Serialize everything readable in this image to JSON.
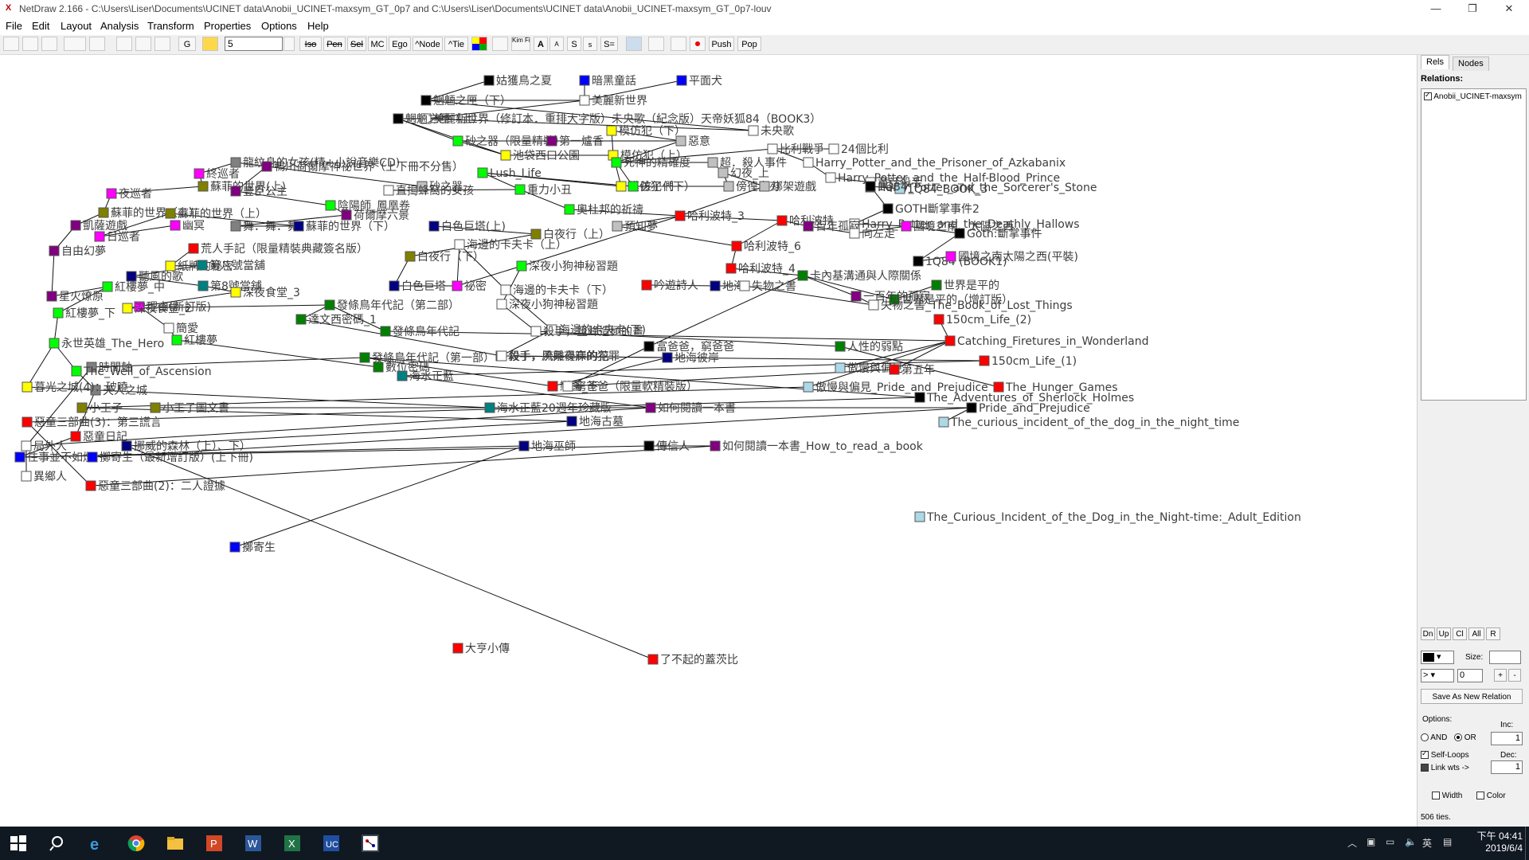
{
  "window": {
    "title": "NetDraw 2.166 - C:\\Users\\Liser\\Documents\\UCINET data\\Anobii_UCINET-maxsym_GT_0p7 and C:\\Users\\Liser\\Documents\\UCINET data\\Anobii_UCINET-maxsym_GT_0p7-louv",
    "app_icon": "netdraw-icon",
    "controls": [
      "—",
      "❐",
      "✕"
    ]
  },
  "menu": [
    "File",
    "Edit",
    "Layout",
    "Analysis",
    "Transform",
    "Properties",
    "Options",
    "Help"
  ],
  "toolbar": {
    "text_buttons": [
      "G",
      "Iso",
      "Pen",
      "Sel",
      "MC",
      "Ego",
      "^Node",
      "^Tie",
      "Kim Fill",
      "A",
      "A",
      "S",
      "s",
      "S=",
      "Push",
      "Pop"
    ],
    "input_value": "5"
  },
  "right_panel": {
    "tabs": [
      "Rels",
      "Nodes"
    ],
    "relations_label": "Relations:",
    "relation_item": "Anobii_UCINET-maxsym",
    "nav_buttons": [
      "Dn",
      "Up",
      "Cl",
      "All",
      "R"
    ],
    "size_label": "Size:",
    "value_field": "0",
    "save_button": "Save As New Relation",
    "options_label": "Options:",
    "and_label": "AND",
    "or_label": "OR",
    "inc_label": "Inc:",
    "inc_value": "1",
    "self_loops_label": "Self-Loops",
    "link_wts_label": "Link wts ->",
    "dec_label": "Dec:",
    "dec_value": "1",
    "width_label": "Width",
    "color_label": "Color",
    "status": "506 ties."
  },
  "taskbar": {
    "time": "下午 04:41",
    "date": "2019/6/4",
    "ime": "英"
  },
  "graph": {
    "nodes": [
      {
        "label": "姑獲鳥之夏",
        "color": "#000000"
      },
      {
        "label": "暗黑童話",
        "color": "#0000ff"
      },
      {
        "label": "平面犬",
        "color": "#0000ff"
      },
      {
        "label": "魍魎之匣（下）",
        "color": "#000000"
      },
      {
        "label": "美麗新世界",
        "color": "#ffffff"
      },
      {
        "label": "美麗新世界（修訂本．重排大字版）未央歌（紀念版）天帝妖狐84（BOOK3）",
        "color": "#ffffff"
      },
      {
        "label": "魍魎之匣（上）",
        "color": "#000000"
      },
      {
        "label": "模仿犯（下）",
        "color": "#ffff00"
      },
      {
        "label": "未央歌",
        "color": "#ffffff"
      },
      {
        "label": "砂之器（限量精裝）",
        "color": "#00ff00"
      },
      {
        "label": "第一爐香",
        "color": "#800080"
      },
      {
        "label": "惡意",
        "color": "#c0c0c0"
      },
      {
        "label": "比利戰爭",
        "color": "#ffffff"
      },
      {
        "label": "24個比利",
        "color": "#ffffff"
      },
      {
        "label": "池袋西口公園",
        "color": "#ffff00"
      },
      {
        "label": "模仿犯（上）",
        "color": "#ffff00"
      },
      {
        "label": "龍紋身的女孩(精+小說音樂CD)",
        "color": "#808080"
      },
      {
        "label": "死神的精確度",
        "color": "#00ff00"
      },
      {
        "label": "超．殺人事件",
        "color": "#c0c0c0"
      },
      {
        "label": "Harry_Potter_and_the_Prisoner_of_Azkabanix",
        "color": "#ffffff"
      },
      {
        "label": "幻夜_上",
        "color": "#c0c0c0"
      },
      {
        "label": "Harry_Potter_and_the_Half-Blood_Prince",
        "color": "#ffffff"
      },
      {
        "label": "鴨川荷爾摩神祕世界（上下冊不分售）",
        "color": "#800080"
      },
      {
        "label": "砂之器",
        "color": "#c0c0c0"
      },
      {
        "label": "模仿犯（下）",
        "color": "#ffff00"
      },
      {
        "label": "孩子們",
        "color": "#00ff00"
      },
      {
        "label": "傍徨之刃",
        "color": "#c0c0c0"
      },
      {
        "label": "童話殺手",
        "color": "#ffffff"
      },
      {
        "label": "Harry_Potter_and_the_Sorcerer's_Stone",
        "color": "#ffffff"
      },
      {
        "label": "終巡者",
        "color": "#ff00ff"
      },
      {
        "label": "蘇菲的世界(上)",
        "color": "#808000"
      },
      {
        "label": "Lush_Life",
        "color": "#00ff00"
      },
      {
        "label": "1Q84_BOOK_3",
        "color": "#add8e6"
      },
      {
        "label": "1Q84",
        "color": "#000000"
      },
      {
        "label": "夜巡者",
        "color": "#ff00ff"
      },
      {
        "label": "蘇菲的世界（上）",
        "color": "#808000"
      },
      {
        "label": "豐臣公主",
        "color": "#800080"
      },
      {
        "label": "直搗蜂窩的女孩",
        "color": "#ffffff"
      },
      {
        "label": "重力小丑",
        "color": "#00ff00"
      },
      {
        "label": "綁架遊戲",
        "color": "#c0c0c0"
      },
      {
        "label": "陰陽師_鳳凰卷",
        "color": "#00ff00"
      },
      {
        "label": "GOTH斷掌事件2",
        "color": "#000000"
      },
      {
        "label": "奧杜邦的祈禱",
        "color": "#00ff00"
      },
      {
        "label": "哈利波特_3",
        "color": "#ff0000"
      },
      {
        "label": "哈利波特",
        "color": "#ff0000"
      },
      {
        "label": "荷爾摩六景",
        "color": "#800080"
      },
      {
        "label": "Harry_Potter_and_the_Deathly_Hallows",
        "color": "#ffffff"
      },
      {
        "label": "國境之南、太陽之西",
        "color": "#ff00ff"
      },
      {
        "label": "蘇菲的世界（上）",
        "color": "#808000"
      },
      {
        "label": "凱薩遊戲",
        "color": "#800080"
      },
      {
        "label": "幽冥",
        "color": "#ff00ff"
      },
      {
        "label": "舞．舞．舞",
        "color": "#808080"
      },
      {
        "label": "蘇菲的世界（下）",
        "color": "#000080"
      },
      {
        "label": "白色巨塔(上)",
        "color": "#000080"
      },
      {
        "label": "百年孤寂",
        "color": "#800080"
      },
      {
        "label": "向左走",
        "color": "#ffffff"
      },
      {
        "label": "Goth:斷掌事件",
        "color": "#000000"
      },
      {
        "label": "日巡者",
        "color": "#ff00ff"
      },
      {
        "label": "預知夢",
        "color": "#c0c0c0"
      },
      {
        "label": "白夜行（上）",
        "color": "#808000"
      },
      {
        "label": "哈利波特_6",
        "color": "#ff0000"
      },
      {
        "label": "自由幻夢",
        "color": "#800080"
      },
      {
        "label": "荒人手記（限量精裝典藏簽名版）",
        "color": "#ff0000"
      },
      {
        "label": "海邊的卡夫卡（上）",
        "color": "#ffffff"
      },
      {
        "label": "1Q84 (BOOK1)",
        "color": "#000000"
      },
      {
        "label": "國境之南太陽之西(平裝)",
        "color": "#ff00ff"
      },
      {
        "label": "白夜行（下）",
        "color": "#808000"
      },
      {
        "label": "世界是平的",
        "color": "#008000"
      },
      {
        "label": "紙牌的秘密",
        "color": "#ffff00"
      },
      {
        "label": "第八號當舖",
        "color": "#008080"
      },
      {
        "label": "深夜小狗神秘習題",
        "color": "#00ff00"
      },
      {
        "label": "哈利波特_4",
        "color": "#ff0000"
      },
      {
        "label": "卡內基溝通與人際關係",
        "color": "#008000"
      },
      {
        "label": "聽風的歌",
        "color": "#000080"
      },
      {
        "label": "白色巨塔",
        "color": "#000080"
      },
      {
        "label": "祕密",
        "color": "#ff00ff"
      },
      {
        "label": "吟遊詩人",
        "color": "#ff0000"
      },
      {
        "label": "地海",
        "color": "#000080"
      },
      {
        "label": "失物之書",
        "color": "#ffffff"
      },
      {
        "label": "世界是平的（增訂版）",
        "color": "#008000"
      },
      {
        "label": "紅樓夢_中",
        "color": "#00ff00"
      },
      {
        "label": "第8號當舖",
        "color": "#008080"
      },
      {
        "label": "深夜食堂_3",
        "color": "#ffff00"
      },
      {
        "label": "星火燎原",
        "color": "#800080"
      },
      {
        "label": "海邊的卡夫卡（下）",
        "color": "#ffffff"
      },
      {
        "label": "一百年的孤寂",
        "color": "#800080"
      },
      {
        "label": "失物之書_The_Book_of_Lost_Things",
        "color": "#ffffff"
      },
      {
        "label": "理由(新訂版)",
        "color": "#ff00ff"
      },
      {
        "label": "深夜食堂_2",
        "color": "#ffff00"
      },
      {
        "label": "發條鳥年代記（第二部）",
        "color": "#008000"
      },
      {
        "label": "深夜小狗神秘習題",
        "color": "#ffffff"
      },
      {
        "label": "紅樓夢_下",
        "color": "#00ff00"
      },
      {
        "label": "達文西密碼_1",
        "color": "#008000"
      },
      {
        "label": "150cm_Life_(2)",
        "color": "#ff0000"
      },
      {
        "label": "簡愛",
        "color": "#ffffff"
      },
      {
        "label": "發條鳥年代記",
        "color": "#008000"
      },
      {
        "label": "海邊的卡夫卡(下)",
        "color": "#ffffff"
      },
      {
        "label": "殺手，登峰造極的畫",
        "color": "#ffffff"
      },
      {
        "label": "紅樓夢",
        "color": "#00ff00"
      },
      {
        "label": "Catching_Firetures_in_Wonderland",
        "color": "#ff0000"
      },
      {
        "label": "永世英雄_The_Hero",
        "color": "#00ff00"
      },
      {
        "label": "殺手，夙興夜寐的犯罪",
        "color": "#ffffff"
      },
      {
        "label": "人性的弱點",
        "color": "#008000"
      },
      {
        "label": "富爸爸，窮爸爸",
        "color": "#000000"
      },
      {
        "label": "發條鳥年代記（第一部）",
        "color": "#008000"
      },
      {
        "label": "殺手，流離尋岸的花",
        "color": "#ffffff"
      },
      {
        "label": "地海彼岸",
        "color": "#000080"
      },
      {
        "label": "時間軸",
        "color": "#808080"
      },
      {
        "label": "數位密碼",
        "color": "#008000"
      },
      {
        "label": "150cm_Life_(1)",
        "color": "#ff0000"
      },
      {
        "label": "The_Well_of_Ascension",
        "color": "#00ff00"
      },
      {
        "label": "傲慢與偏見",
        "color": "#add8e6"
      },
      {
        "label": "海水正藍",
        "color": "#008080"
      },
      {
        "label": "第五年",
        "color": "#ff0000"
      },
      {
        "label": "天人之城",
        "color": "#808080"
      },
      {
        "label": "暮光之城(4)：破曉",
        "color": "#ffff00"
      },
      {
        "label": "戀園_下",
        "color": "#ff0000"
      },
      {
        "label": "The_Hunger_Games",
        "color": "#ff0000"
      },
      {
        "label": "傲慢與偏見_Pride_and_Prejudice",
        "color": "#add8e6"
      },
      {
        "label": "窮爸爸（限量軟精裝版）",
        "color": "#ffffff"
      },
      {
        "label": "The_Adventures_of_Sherlock_Holmes",
        "color": "#000000"
      },
      {
        "label": "小王子",
        "color": "#808000"
      },
      {
        "label": "小王子圖文書",
        "color": "#808000"
      },
      {
        "label": "海水正藍20週年珍藏版",
        "color": "#008080"
      },
      {
        "label": "如何閱讀一本書",
        "color": "#800080"
      },
      {
        "label": "Pride_and_Prejudice",
        "color": "#000000"
      },
      {
        "label": "惡童三部曲(3)：第三謊言",
        "color": "#ff0000"
      },
      {
        "label": "地海古墓",
        "color": "#000080"
      },
      {
        "label": "The_curious_incident_of_the_dog_in_the_night_time",
        "color": "#add8e6"
      },
      {
        "label": "惡童日記",
        "color": "#ff0000"
      },
      {
        "label": "局外人",
        "color": "#ffffff"
      },
      {
        "label": "挪威的森林（上）、下）",
        "color": "#000080"
      },
      {
        "label": "往事並不如煙",
        "color": "#0000ff"
      },
      {
        "label": "擲寄生（最新增訂版）(上下冊)",
        "color": "#0000ff"
      },
      {
        "label": "地海巫師",
        "color": "#000080"
      },
      {
        "label": "傳信人",
        "color": "#000000"
      },
      {
        "label": "如何閱讀一本書_How_to_read_a_book",
        "color": "#800080"
      },
      {
        "label": "異鄉人",
        "color": "#ffffff"
      },
      {
        "label": "惡童三部曲(2)：二人證據",
        "color": "#ff0000"
      },
      {
        "label": "The_Curious_Incident_of_the_Dog_in_the_Night-time:_Adult_Edition",
        "color": "#add8e6"
      },
      {
        "label": "擲寄生",
        "color": "#0000ff"
      },
      {
        "label": "大亨小傳",
        "color": "#ff0000"
      },
      {
        "label": "了不起的蓋茨比",
        "color": "#ff0000"
      }
    ],
    "edges": [
      [
        0,
        3
      ],
      [
        1,
        4
      ],
      [
        2,
        4
      ],
      [
        3,
        4
      ],
      [
        4,
        5
      ],
      [
        5,
        6
      ],
      [
        5,
        8
      ],
      [
        6,
        9
      ],
      [
        9,
        10
      ],
      [
        9,
        14
      ],
      [
        10,
        11
      ],
      [
        7,
        11
      ],
      [
        12,
        13
      ],
      [
        12,
        19
      ],
      [
        11,
        17
      ],
      [
        17,
        18
      ],
      [
        17,
        25
      ],
      [
        18,
        20
      ],
      [
        19,
        21
      ],
      [
        21,
        27
      ],
      [
        27,
        28
      ],
      [
        27,
        33
      ],
      [
        33,
        32
      ],
      [
        33,
        41
      ],
      [
        41,
        46
      ],
      [
        46,
        47
      ],
      [
        47,
        56
      ],
      [
        56,
        64
      ],
      [
        64,
        65
      ],
      [
        16,
        22
      ],
      [
        22,
        23
      ],
      [
        16,
        29
      ],
      [
        29,
        30
      ],
      [
        30,
        34
      ],
      [
        34,
        35
      ],
      [
        35,
        49
      ],
      [
        49,
        61
      ],
      [
        61,
        83
      ],
      [
        83,
        80
      ],
      [
        80,
        91
      ],
      [
        91,
        100
      ],
      [
        100,
        110
      ],
      [
        110,
        114
      ],
      [
        114,
        129
      ],
      [
        129,
        132
      ],
      [
        132,
        134
      ],
      [
        134,
        140
      ],
      [
        140,
        143
      ],
      [
        132,
        135
      ],
      [
        135,
        136
      ],
      [
        136,
        138
      ],
      [
        22,
        36
      ],
      [
        36,
        40
      ],
      [
        40,
        45
      ],
      [
        45,
        51
      ],
      [
        51,
        52
      ],
      [
        52,
        48
      ],
      [
        48,
        57
      ],
      [
        57,
        50
      ],
      [
        37,
        38
      ],
      [
        38,
        42
      ],
      [
        42,
        43
      ],
      [
        43,
        44
      ],
      [
        44,
        54
      ],
      [
        54,
        55
      ],
      [
        55,
        47
      ],
      [
        44,
        60
      ],
      [
        60,
        71
      ],
      [
        71,
        72
      ],
      [
        72,
        85
      ],
      [
        85,
        86
      ],
      [
        53,
        59
      ],
      [
        59,
        66
      ],
      [
        66,
        74
      ],
      [
        74,
        75
      ],
      [
        75,
        63
      ],
      [
        63,
        84
      ],
      [
        84,
        96
      ],
      [
        96,
        101
      ],
      [
        101,
        106
      ],
      [
        106,
        116
      ],
      [
        116,
        104
      ],
      [
        104,
        107
      ],
      [
        107,
        130
      ],
      [
        130,
        137
      ],
      [
        104,
        120
      ],
      [
        120,
        126
      ],
      [
        126,
        138
      ],
      [
        58,
        60
      ],
      [
        58,
        43
      ],
      [
        62,
        68
      ],
      [
        68,
        69
      ],
      [
        69,
        73
      ],
      [
        73,
        81
      ],
      [
        81,
        82
      ],
      [
        82,
        88
      ],
      [
        88,
        89
      ],
      [
        89,
        92
      ],
      [
        92,
        105
      ],
      [
        105,
        109
      ],
      [
        109,
        112
      ],
      [
        112,
        124
      ],
      [
        124,
        130
      ],
      [
        70,
        75
      ],
      [
        70,
        90
      ],
      [
        90,
        97
      ],
      [
        97,
        102
      ],
      [
        102,
        117
      ],
      [
        76,
        77
      ],
      [
        77,
        78
      ],
      [
        78,
        86
      ],
      [
        67,
        79
      ],
      [
        79,
        72
      ],
      [
        95,
        99
      ],
      [
        95,
        89
      ],
      [
        87,
        94
      ],
      [
        94,
        98
      ],
      [
        98,
        108
      ],
      [
        93,
        99
      ],
      [
        99,
        111
      ],
      [
        99,
        118
      ],
      [
        99,
        113
      ],
      [
        113,
        119
      ],
      [
        118,
        121
      ],
      [
        121,
        127
      ],
      [
        127,
        131
      ],
      [
        131,
        142
      ],
      [
        119,
        103
      ],
      [
        103,
        72
      ],
      [
        12,
        17
      ],
      [
        26,
        25
      ],
      [
        25,
        31
      ],
      [
        31,
        38
      ],
      [
        20,
        26
      ],
      [
        20,
        39
      ],
      [
        39,
        43
      ],
      [
        43,
        70
      ],
      [
        7,
        15
      ],
      [
        15,
        24
      ],
      [
        24,
        31
      ],
      [
        14,
        15
      ],
      [
        115,
        123
      ],
      [
        123,
        125
      ],
      [
        125,
        128
      ],
      [
        125,
        133
      ],
      [
        122,
        123
      ],
      [
        100,
        115
      ],
      [
        144,
        145
      ],
      [
        3,
        8
      ],
      [
        6,
        14
      ]
    ]
  }
}
